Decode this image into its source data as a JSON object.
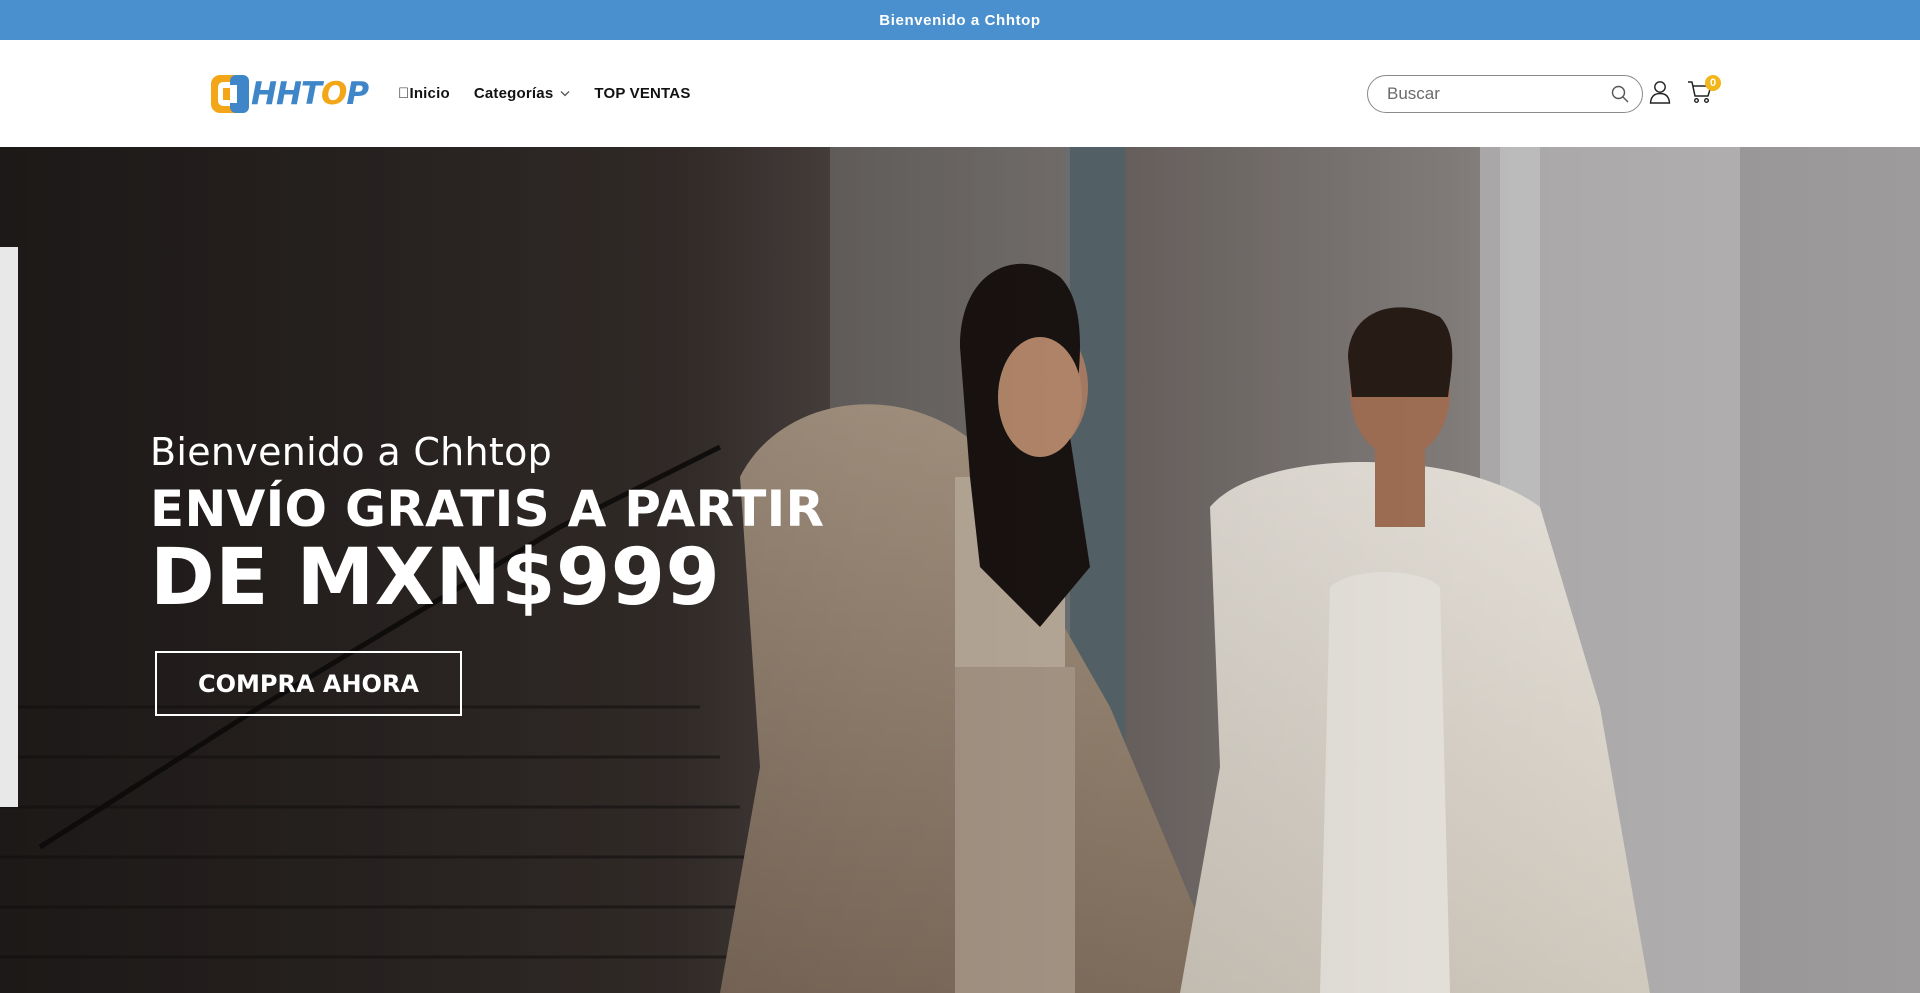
{
  "announcement": {
    "text": "Bienvenido a Chhtop"
  },
  "brand": {
    "logo_text": "CHHTOP",
    "colors": {
      "primary": "#3f86c9",
      "accent": "#f2a618",
      "announcement_bg": "#4a90cf"
    }
  },
  "nav": {
    "items": [
      {
        "label": "\u0000Inicio",
        "icon": "home-glyph"
      },
      {
        "label": "Categorías",
        "icon": "chevron-down-icon"
      },
      {
        "label": "TOP VENTAS"
      }
    ]
  },
  "search": {
    "placeholder": "Buscar",
    "icon": "search-icon"
  },
  "account": {
    "icon": "user-icon"
  },
  "cart": {
    "icon": "cart-icon",
    "count": "0"
  },
  "hero": {
    "subtitle": "Bienvenido a Chhtop",
    "title_line1": "ENVÍO GRATIS A PARTIR",
    "title_line2": "DE MXN$999",
    "cta_label": "COMPRA AHORA",
    "image": "two-women-in-winter-coats"
  }
}
